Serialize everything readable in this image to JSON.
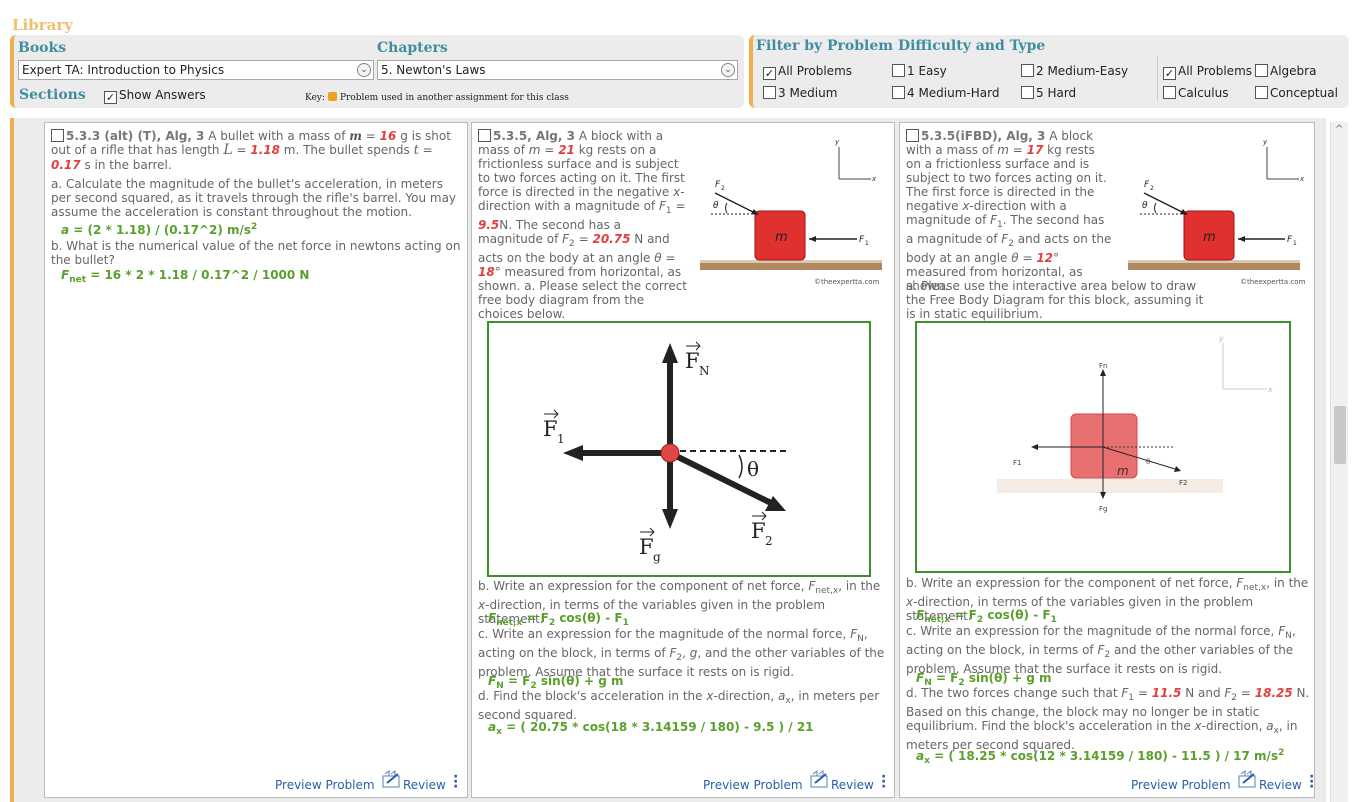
{
  "library": {
    "title": "Library"
  },
  "books": {
    "title": "Books",
    "selected": "Expert TA:  Introduction to Physics"
  },
  "chapters": {
    "title": "Chapters",
    "selected": "5. Newton's Laws"
  },
  "sections": {
    "title": "Sections",
    "show_answers": "Show Answers",
    "key_label": "Key:",
    "key_text": "Problem used in another assignment for this class"
  },
  "filter": {
    "title": "Filter by Problem Difficulty and Type",
    "difficulty": [
      {
        "label": "All Problems",
        "checked": true
      },
      {
        "label": "1 Easy",
        "checked": false
      },
      {
        "label": "2 Medium-Easy",
        "checked": false
      },
      {
        "label": "3 Medium",
        "checked": false
      },
      {
        "label": "4 Medium-Hard",
        "checked": false
      },
      {
        "label": "5 Hard",
        "checked": false
      }
    ],
    "type": [
      {
        "label": "All Problems",
        "checked": true
      },
      {
        "label": "Algebra",
        "checked": false
      },
      {
        "label": "Calculus",
        "checked": false
      },
      {
        "label": "Conceptual",
        "checked": false
      }
    ]
  },
  "cards": [
    {
      "header": "5.3.3 (alt) (T), Alg, 3",
      "intro": "A bullet with a mass of",
      "m_var": "m",
      "eq": "=",
      "m_val": "16",
      "t1": "g is shot out of a rifle that has length",
      "L_var": "L",
      "L_val": "1.18",
      "t2": "m. The bullet spends",
      "t_var": "t",
      "t_val": "0.17",
      "t3": "s in the barrel.",
      "qa": "a. Calculate the magnitude of the bullet's acceleration, in meters per second squared, as it travels through the rifle's barrel. You may assume the acceleration is constant throughout the motion.",
      "ans_a_lhs": "a",
      "ans_a": "= (2 * 1.18) / (0.17^2)  m/s",
      "ans_a_exp": "2",
      "qb": "b. What is the numerical value of the net force in newtons acting on the bullet?",
      "ans_b_lhs": "F",
      "ans_b_sub": "net",
      "ans_b": "= 16 * 2 * 1.18 / 0.17^2 / 1000  N",
      "preview": "Preview Problem",
      "review": "Review"
    },
    {
      "header": "5.3.5, Alg, 3",
      "intro": "A block with a mass of",
      "m_var": "m",
      "eq": "=",
      "m_val": "21",
      "t1": "kg rests on a frictionless surface and is subject to two forces acting on it. The first force is directed in the negative",
      "x_var": "x",
      "t2": "-direction with a magnitude of",
      "f1_var": "F",
      "f1_sub": "1",
      "f1_val": "9.5",
      "t3": "N. The second has a magnitude of",
      "f2_var": "F",
      "f2_sub": "2",
      "f2_val": "20.75",
      "t4": "N and acts on the body at an angle",
      "th_var": "θ",
      "th_val": "18",
      "t5": "° measured from horizontal, as shown.",
      "qa": "a. Please select the correct free body diagram from the choices below.",
      "qb_1": "b. Write an expression for the component of net force,",
      "qb_var": "F",
      "qb_sub": "net,x",
      "qb_2": ", in the",
      "qb_x": "x",
      "qb_3": "-direction, in terms of the variables given in the problem statement.",
      "ans_b_lhs": "F",
      "ans_b_sub": "net,x",
      "ans_b": "= F",
      "ans_b_s2": "2",
      "ans_b_rest": " cos(θ) - F",
      "ans_b_s1": "1",
      "qc_1": "c. Write an expression for the magnitude of the normal force,",
      "qc_var": "F",
      "qc_sub": "N",
      "qc_2": ", acting on the block, in terms of",
      "qc_f2": "F",
      "qc_f2_sub": "2",
      "qc_3": ",",
      "qc_g": "g",
      "qc_4": ", and the other variables of the problem. Assume that the surface it rests on is rigid.",
      "ans_c_lhs": "F",
      "ans_c_sub": "N",
      "ans_c": "= F",
      "ans_c_s2": "2",
      "ans_c_rest": " sin(θ) + g m",
      "qd_1": "d. Find the block's acceleration in the",
      "qd_x": "x",
      "qd_2": "-direction,",
      "qd_var": "a",
      "qd_sub": "x",
      "qd_3": ", in meters per second squared.",
      "ans_d_lhs": "a",
      "ans_d_sub": "x",
      "ans_d": "= ( 20.75 * cos(18 * 3.14159 / 180) - 9.5 ) / 21",
      "fig": {
        "m": "m",
        "f1": "F",
        "f1_sub": "1",
        "f2": "F",
        "f2_sub": "2",
        "theta": "θ",
        "x": "x",
        "y": "y",
        "credit": "©theexpertta.com"
      },
      "fbd": {
        "fn": "F",
        "fn_sub": "N",
        "f1": "F",
        "f1_sub": "1",
        "fg": "F",
        "fg_sub": "g",
        "f2": "F",
        "f2_sub": "2",
        "theta": "θ"
      },
      "preview": "Preview Problem",
      "review": "Review"
    },
    {
      "header": "5.3.5(iFBD), Alg, 3",
      "intro": "A block with a mass of",
      "m_var": "m",
      "eq": "=",
      "m_val": "17",
      "t1": "kg rests on a frictionless surface and is subject to two forces acting on it. The first force is directed in the negative",
      "x_var": "x",
      "t2": "-direction with a magnitude of",
      "f1_var": "F",
      "f1_sub": "1",
      "t3": ". The second has a magnitude of",
      "f2_var": "F",
      "f2_sub": "2",
      "t4": "and acts on the body at an angle",
      "th_var": "θ",
      "th_val": "12",
      "t5": "° measured from horizontal, as shown.",
      "qa": "a. Please use the interactive area below to draw the Free Body Diagram for this block, assuming it is in static equilibrium.",
      "qb_1": "b. Write an expression for the component of net force,",
      "qb_var": "F",
      "qb_sub": "net,x",
      "qb_2": ", in the",
      "qb_x": "x",
      "qb_3": "-direction, in terms of the variables given in the problem statement.",
      "ans_b_lhs": "F",
      "ans_b_sub": "net,x",
      "ans_b": "= F",
      "ans_b_s2": "2",
      "ans_b_rest": " cos(θ) - F",
      "ans_b_s1": "1",
      "qc_1": "c. Write an expression for the magnitude of the normal force,",
      "qc_var": "F",
      "qc_sub": "N",
      "qc_2": ", acting on the block, in terms of",
      "qc_f2": "F",
      "qc_f2_sub": "2",
      "qc_3": "and the other variables of the problem. Assume that the surface it rests on is rigid.",
      "ans_c_lhs": "F",
      "ans_c_sub": "N",
      "ans_c": "= F",
      "ans_c_s2": "2",
      "ans_c_rest": " sin(θ) + g m",
      "qd_1": "d. The two forces change such that",
      "qd_f1": "F",
      "qd_f1_sub": "1",
      "qd_eq": "=",
      "qd_f1_val": "11.5",
      "qd_2": "N and",
      "qd_f2": "F",
      "qd_f2_sub": "2",
      "qd_f2_val": "18.25",
      "qd_3": "N. Based on this change, the block may no longer be in static equilibrium. Find the block's acceleration in the",
      "qd_x": "x",
      "qd_4": "-direction,",
      "qd_var": "a",
      "qd_sub": "x",
      "qd_5": ", in meters per second squared.",
      "ans_d_lhs": "a",
      "ans_d_sub": "x",
      "ans_d": "= ( 18.25 * cos(12 * 3.14159 / 180) - 11.5 ) / 17  m/s",
      "ans_d_exp": "2",
      "fig": {
        "m": "m",
        "f1": "F",
        "f1_sub": "1",
        "f2": "F",
        "f2_sub": "2",
        "theta": "θ",
        "x": "x",
        "y": "y",
        "credit": "©theexpertta.com"
      },
      "ifbd": {
        "fn": "Fn",
        "f1": "F1",
        "f2": "F2",
        "fg": "Fg",
        "m": "m",
        "theta": "θ",
        "x": "x",
        "y": "y"
      },
      "preview": "Preview Problem",
      "review": "Review"
    }
  ],
  "colors": {
    "accent": "#f0b050",
    "title": "#3f8ea0",
    "answer": "#5aa02c",
    "variable": "#e04040",
    "link": "#2a5fa8"
  }
}
